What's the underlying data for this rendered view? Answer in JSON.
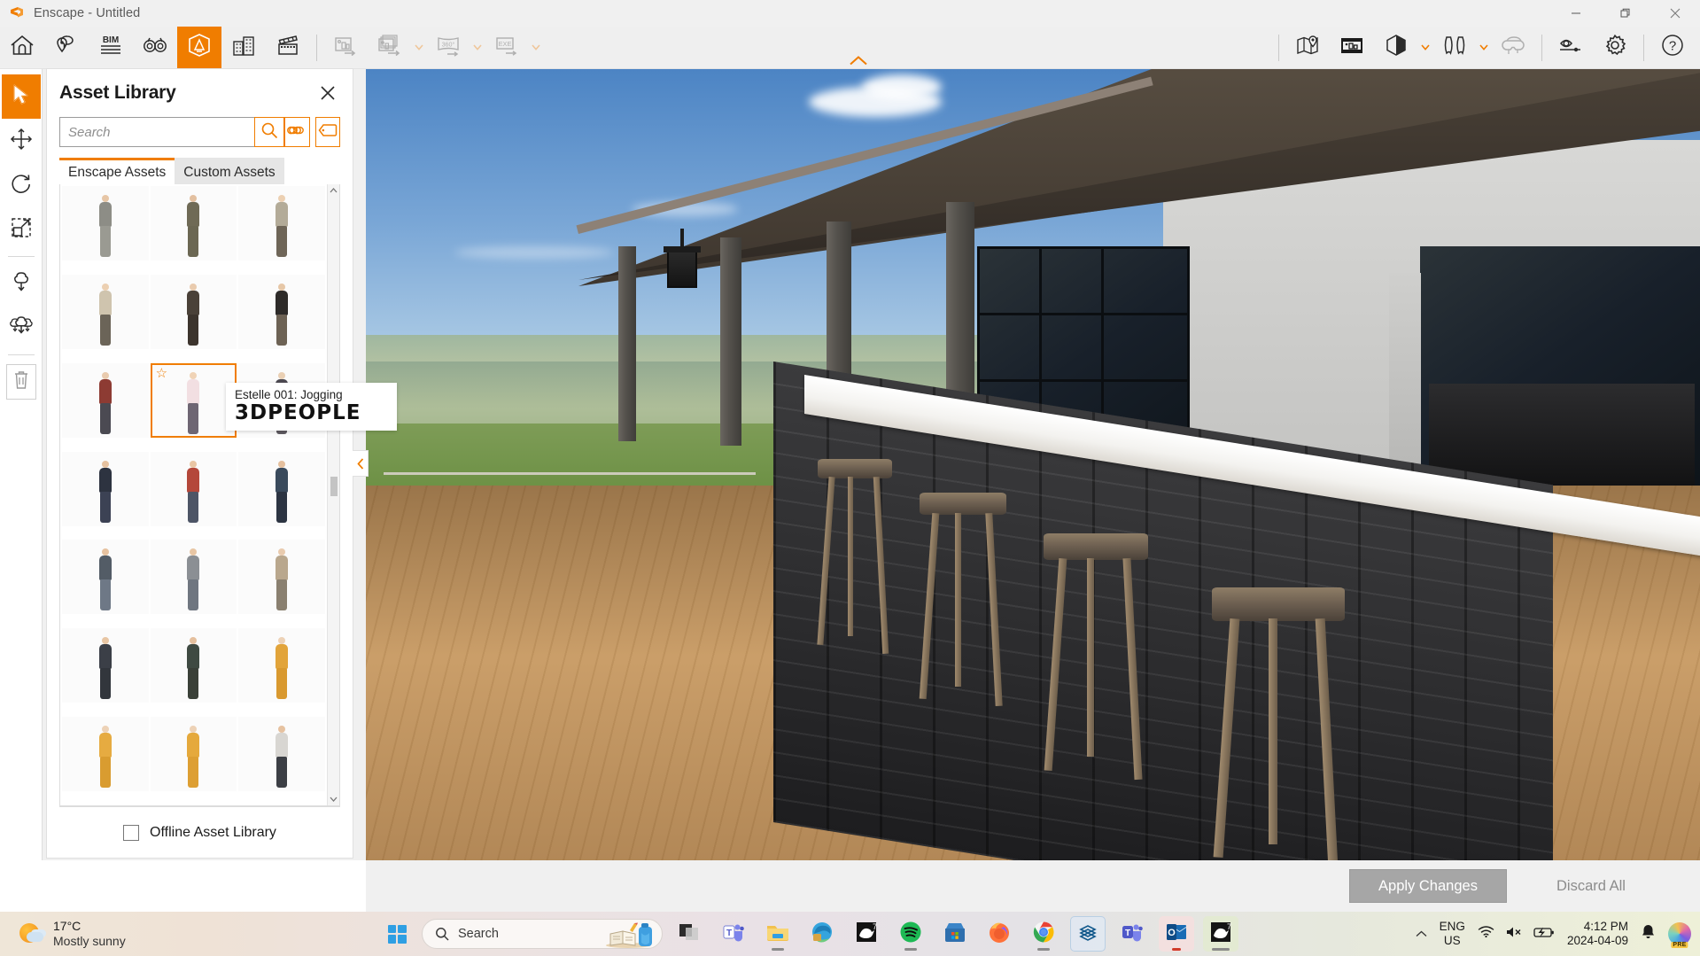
{
  "window": {
    "title": "Enscape - Untitled",
    "app_logo_icon": "enscape-logo-icon",
    "controls": {
      "minimize": "minimize-icon",
      "restore": "restore-icon",
      "close": "close-icon"
    }
  },
  "toolbar": {
    "left_items": [
      {
        "name": "home-button",
        "icon": "home-icon",
        "state": "enabled"
      },
      {
        "name": "feedback-button",
        "icon": "location-chat-icon",
        "state": "enabled"
      },
      {
        "name": "bim-button",
        "icon": "bim-icon",
        "state": "enabled"
      },
      {
        "name": "visual-settings-button",
        "icon": "binoculars-icon",
        "state": "enabled"
      },
      {
        "name": "asset-library-button",
        "icon": "asset-library-icon",
        "state": "active"
      },
      {
        "name": "site-context-button",
        "icon": "buildings-icon",
        "state": "enabled"
      },
      {
        "name": "video-editor-button",
        "icon": "clapperboard-icon",
        "state": "enabled"
      },
      {
        "name": "render-image-button",
        "icon": "export-image-icon",
        "state": "disabled"
      },
      {
        "name": "batch-render-button",
        "icon": "export-batch-icon",
        "state": "disabled"
      },
      {
        "name": "panorama-button",
        "icon": "panorama-360-icon",
        "state": "disabled"
      },
      {
        "name": "exe-export-button",
        "icon": "exe-export-icon",
        "state": "disabled"
      }
    ],
    "right_items": [
      {
        "name": "map-button",
        "icon": "map-pin-icon",
        "state": "enabled"
      },
      {
        "name": "project-gallery-button",
        "icon": "gallery-icon",
        "state": "enabled"
      },
      {
        "name": "rendering-style-button",
        "icon": "hexagon-contrast-icon",
        "state": "enabled"
      },
      {
        "name": "view-management-button",
        "icon": "curtains-icon",
        "state": "enabled"
      },
      {
        "name": "vr-button",
        "icon": "vr-headset-icon",
        "state": "disabled"
      },
      {
        "name": "preview-mode-button",
        "icon": "eye-slider-icon",
        "state": "enabled"
      },
      {
        "name": "settings-button",
        "icon": "gear-icon",
        "state": "enabled"
      },
      {
        "name": "help-button",
        "icon": "question-circle-icon",
        "state": "enabled"
      }
    ],
    "labels": {
      "bim": "BIM",
      "panorama": "360°",
      "exe": "EXE"
    },
    "collapse_arrow_icon": "chevron-up-icon"
  },
  "left_tools": [
    {
      "name": "select-tool",
      "icon": "cursor-arrow-icon",
      "state": "active"
    },
    {
      "name": "move-tool",
      "icon": "move-arrows-icon",
      "state": "enabled"
    },
    {
      "name": "rotate-tool",
      "icon": "rotate-icon",
      "state": "enabled"
    },
    {
      "name": "scale-tool",
      "icon": "scale-icon",
      "state": "enabled"
    },
    {
      "name": "place-asset-tool",
      "icon": "tree-place-icon",
      "state": "enabled"
    },
    {
      "name": "asset-brush-tool",
      "icon": "tree-brush-icon",
      "state": "enabled"
    },
    {
      "name": "delete-tool",
      "icon": "trash-icon",
      "state": "enabled"
    }
  ],
  "asset_panel": {
    "title": "Asset Library",
    "close_icon": "close-icon",
    "search": {
      "placeholder": "Search",
      "value": "",
      "search_icon": "magnifier-icon",
      "link_icon": "infinity-link-icon",
      "tag_icon": "tag-icon"
    },
    "tabs": [
      {
        "label": "Enscape Assets",
        "active": true
      },
      {
        "label": "Custom Assets",
        "active": false
      }
    ],
    "scroll": {
      "up_icon": "chevron-up-icon",
      "down_icon": "chevron-down-icon"
    },
    "footer": {
      "checkbox_label": "Offline Asset Library",
      "checked": false
    },
    "assets": [
      {
        "id": 1,
        "alt": "man-sitting-suit",
        "top": "#8d8d86",
        "bottom": "#9a9a92",
        "skin": "#e7c6a6"
      },
      {
        "id": 2,
        "alt": "man-phone-coat",
        "top": "#6f6a56",
        "bottom": "#6b6753",
        "skin": "#e3c0a0"
      },
      {
        "id": 3,
        "alt": "woman-long-coat",
        "top": "#b3ab98",
        "bottom": "#6e6557",
        "skin": "#ecd0b2"
      },
      {
        "id": 4,
        "alt": "woman-vest-blonde",
        "top": "#cfc4ae",
        "bottom": "#6b6458",
        "skin": "#ecd0b2"
      },
      {
        "id": 5,
        "alt": "woman-sitting-suit",
        "top": "#4a4138",
        "bottom": "#3c342d",
        "skin": "#e9cbae"
      },
      {
        "id": 6,
        "alt": "woman-jacket-bag",
        "top": "#2e2b29",
        "bottom": "#6d6254",
        "skin": "#e6c7a7"
      },
      {
        "id": 7,
        "alt": "woman-red-scarf",
        "top": "#8d3b33",
        "bottom": "#4b4a52",
        "skin": "#e9cbae"
      },
      {
        "id": 8,
        "alt": "Estelle 001: Jogging",
        "top": "#f2dfe2",
        "bottom": "#6e6673",
        "skin": "#f0d3b6",
        "selected": true,
        "favorite": true
      },
      {
        "id": 9,
        "alt": "woman-walking-dark",
        "top": "#4d4a52",
        "bottom": "#5e5a60",
        "skin": "#ead0b4"
      },
      {
        "id": 10,
        "alt": "man-dark-jacket",
        "top": "#2d3340",
        "bottom": "#3c4254",
        "skin": "#e6c2a0"
      },
      {
        "id": 11,
        "alt": "man-red-shirt",
        "top": "#b4473a",
        "bottom": "#4d5566",
        "skin": "#e9c6a4"
      },
      {
        "id": 12,
        "alt": "man-on-bicycle",
        "top": "#3a4a5c",
        "bottom": "#2c3442",
        "skin": "#e5c09e"
      },
      {
        "id": 13,
        "alt": "man-crouching-camera",
        "top": "#535c66",
        "bottom": "#6e7886",
        "skin": "#e6c2a0"
      },
      {
        "id": 14,
        "alt": "man-grey-tshirt",
        "top": "#8b8f94",
        "bottom": "#6f7680",
        "skin": "#e8c6a4"
      },
      {
        "id": 15,
        "alt": "man-kneeling-tan",
        "top": "#b9a78d",
        "bottom": "#8a8070",
        "skin": "#e9cbae"
      },
      {
        "id": 16,
        "alt": "man-business-suit",
        "top": "#3b3f47",
        "bottom": "#32363c",
        "skin": "#e8c6a4"
      },
      {
        "id": 17,
        "alt": "man-bicycle-coat",
        "top": "#3f4a42",
        "bottom": "#3a4038",
        "skin": "#e5c09e"
      },
      {
        "id": 18,
        "alt": "woman-yellow-dress",
        "top": "#e2a43a",
        "bottom": "#d9992f",
        "skin": "#edd2b6"
      },
      {
        "id": 19,
        "alt": "woman-yellow-coat",
        "top": "#e6ab41",
        "bottom": "#d99c30",
        "skin": "#edd2b6"
      },
      {
        "id": 20,
        "alt": "woman-yellow-skirt",
        "top": "#e5a93c",
        "bottom": "#dd9f33",
        "skin": "#edd2b6"
      },
      {
        "id": 21,
        "alt": "man-sitting-ground",
        "top": "#d8d6d2",
        "bottom": "#3c3f45",
        "skin": "#e6c2a0"
      }
    ]
  },
  "tooltip": {
    "title": "Estelle 001: Jogging",
    "brand": "3DPEOPLE",
    "visible": true
  },
  "action_bar": {
    "apply_label": "Apply Changes",
    "discard_label": "Discard All"
  },
  "panel_collapse_tab_icon": "chevron-left-icon",
  "taskbar": {
    "weather": {
      "temperature": "17°C",
      "condition": "Mostly sunny",
      "icon": "sun-cloud-icon"
    },
    "start_icon": "windows-start-icon",
    "search": {
      "placeholder": "Search",
      "icon": "magnifier-icon"
    },
    "apps": [
      {
        "name": "task-view-button",
        "icon": "task-view-icon",
        "running": false
      },
      {
        "name": "teams-button",
        "icon": "teams-icon",
        "running": false
      },
      {
        "name": "file-explorer-button",
        "icon": "folder-icon",
        "running": true
      },
      {
        "name": "edge-button",
        "icon": "edge-icon",
        "running": false
      },
      {
        "name": "rhino-button",
        "icon": "rhino-icon",
        "running": false
      },
      {
        "name": "spotify-button",
        "icon": "spotify-icon",
        "running": true
      },
      {
        "name": "store-button",
        "icon": "microsoft-store-icon",
        "running": false
      },
      {
        "name": "firefox-button",
        "icon": "firefox-icon",
        "running": false
      },
      {
        "name": "chrome-button",
        "icon": "chrome-icon",
        "running": true
      },
      {
        "name": "sketchup-button",
        "icon": "sketchup-icon",
        "running": false
      },
      {
        "name": "teams2-button",
        "icon": "teams-icon",
        "running": false
      },
      {
        "name": "outlook-button",
        "icon": "outlook-icon",
        "running": true
      },
      {
        "name": "rhino-active-button",
        "icon": "rhino-icon",
        "running": true
      }
    ],
    "tray": {
      "chevron_icon": "chevron-up-icon",
      "language": {
        "line1": "ENG",
        "line2": "US"
      },
      "wifi_icon": "wifi-icon",
      "volume_icon": "volume-muted-icon",
      "battery_icon": "battery-charging-icon",
      "time": "4:12 PM",
      "date": "2024-04-09",
      "notification_icon": "bell-icon",
      "copilot_icon": "copilot-icon",
      "copilot_badge": "PRE"
    }
  },
  "colors": {
    "accent": "#f07d00",
    "panel_bg": "#ffffff",
    "chrome_bg": "#efefef",
    "title_text": "#5a5a5a"
  }
}
